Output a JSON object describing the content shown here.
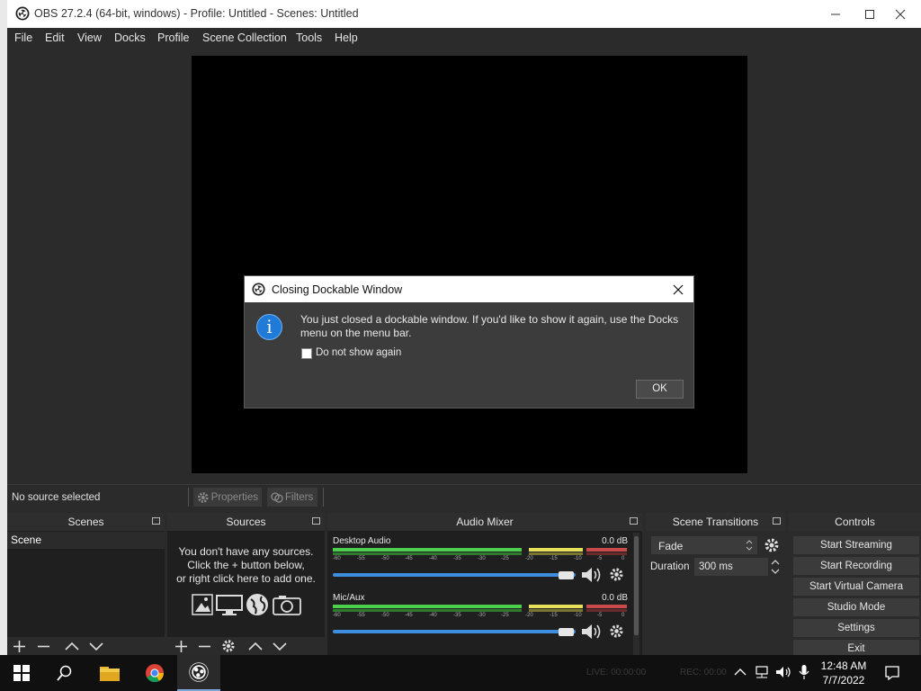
{
  "window": {
    "title": "OBS 27.2.4 (64-bit, windows) - Profile: Untitled - Scenes: Untitled"
  },
  "menu": [
    "File",
    "Edit",
    "View",
    "Docks",
    "Profile",
    "Scene Collection",
    "Tools",
    "Help"
  ],
  "dialog": {
    "title": "Closing Dockable Window",
    "message": "You just closed a dockable window. If you'd like to show it again, use the Docks menu on the menu bar.",
    "checkbox_label": "Do not show again",
    "checkbox_checked": false,
    "ok_label": "OK"
  },
  "source_toolbar": {
    "status": "No source selected",
    "properties_label": "Properties",
    "filters_label": "Filters"
  },
  "docks": {
    "scenes": {
      "title": "Scenes",
      "items": [
        "Scene"
      ]
    },
    "sources": {
      "title": "Sources",
      "empty_line1": "You don't have any sources.",
      "empty_line2": "Click the + button below,",
      "empty_line3": "or right click here to add one."
    },
    "mixer": {
      "title": "Audio Mixer",
      "ticks": [
        "-60",
        "-55",
        "-50",
        "-45",
        "-40",
        "-35",
        "-30",
        "-25",
        "-20",
        "-15",
        "-10",
        "-5",
        "0"
      ],
      "channels": [
        {
          "name": "Desktop Audio",
          "db": "0.0 dB"
        },
        {
          "name": "Mic/Aux",
          "db": "0.0 dB"
        }
      ]
    },
    "transitions": {
      "title": "Scene Transitions",
      "selected": "Fade",
      "duration_label": "Duration",
      "duration_value": "300 ms"
    },
    "controls": {
      "title": "Controls",
      "buttons": [
        "Start Streaming",
        "Start Recording",
        "Start Virtual Camera",
        "Studio Mode",
        "Settings",
        "Exit"
      ]
    }
  },
  "status": {
    "live": "LIVE: 00:00:00",
    "rec": "REC: 00:00"
  },
  "clock": {
    "time": "12:48 AM",
    "date": "7/7/2022"
  }
}
